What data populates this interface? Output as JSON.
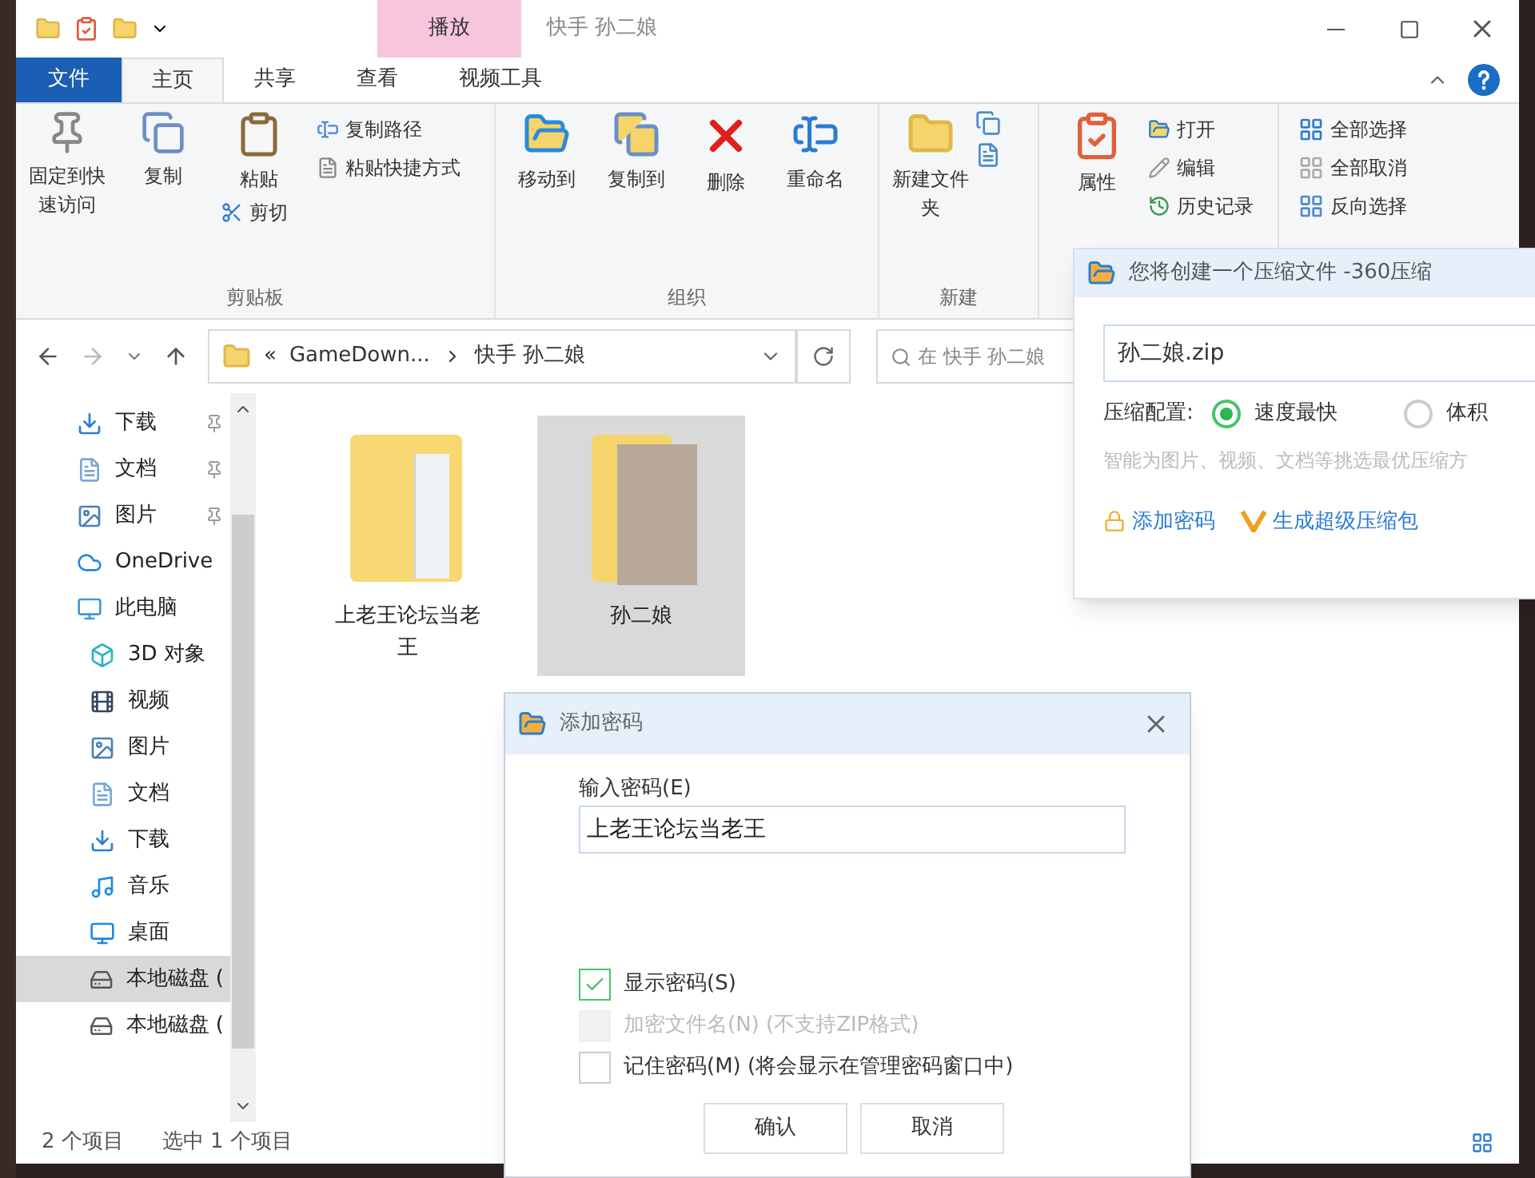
{
  "window": {
    "title": "快手 孙二娘",
    "context_tab": "播放"
  },
  "tabs": [
    {
      "label": "文件",
      "kind": "file",
      "selected": false
    },
    {
      "label": "主页",
      "kind": "tab",
      "selected": true
    },
    {
      "label": "共享",
      "kind": "tab",
      "selected": false
    },
    {
      "label": "查看",
      "kind": "tab",
      "selected": false
    },
    {
      "label": "视频工具",
      "kind": "context",
      "selected": false
    }
  ],
  "ribbon": {
    "clipboard": {
      "label": "剪贴板",
      "pin": "固定到快速访问",
      "copy": "复制",
      "paste": "粘贴",
      "cut": "剪切",
      "copy_path": "复制路径",
      "paste_shortcut": "粘贴快捷方式"
    },
    "organize": {
      "label": "组织",
      "move_to": "移动到",
      "copy_to": "复制到",
      "delete": "删除",
      "rename": "重命名"
    },
    "new": {
      "label": "新建",
      "new_folder": "新建文件夹"
    },
    "open": {
      "properties": "属性",
      "open": "打开",
      "edit": "编辑",
      "history": "历史记录"
    },
    "select": {
      "select_all": "全部选择",
      "select_none": "全部取消",
      "invert": "反向选择"
    }
  },
  "address": {
    "overflow": "«",
    "parent": "GameDown...",
    "current": "快手 孙二娘",
    "search_placeholder": "在 快手 孙二娘"
  },
  "nav": [
    {
      "label": "下载",
      "kind": "download",
      "pinned": true,
      "selected": false
    },
    {
      "label": "文档",
      "kind": "doc",
      "pinned": true,
      "selected": false
    },
    {
      "label": "图片",
      "kind": "image",
      "pinned": true,
      "selected": false
    },
    {
      "label": "OneDrive",
      "kind": "cloud",
      "pinned": false,
      "selected": false
    },
    {
      "label": "此电脑",
      "kind": "pc",
      "pinned": false,
      "selected": false,
      "children": [
        {
          "label": "3D 对象",
          "kind": "cube",
          "pinned": false,
          "selected": false
        },
        {
          "label": "视频",
          "kind": "video",
          "pinned": false,
          "selected": false
        },
        {
          "label": "图片",
          "kind": "image",
          "pinned": false,
          "selected": false
        },
        {
          "label": "文档",
          "kind": "doc",
          "pinned": false,
          "selected": false
        },
        {
          "label": "下载",
          "kind": "download",
          "pinned": false,
          "selected": false
        },
        {
          "label": "音乐",
          "kind": "music",
          "pinned": false,
          "selected": false
        },
        {
          "label": "桌面",
          "kind": "desktop",
          "pinned": false,
          "selected": false
        },
        {
          "label": "本地磁盘 (",
          "kind": "drive",
          "pinned": false,
          "selected": true
        },
        {
          "label": "本地磁盘 (",
          "kind": "drive",
          "pinned": false,
          "selected": false
        }
      ]
    }
  ],
  "files": [
    {
      "name": "上老王论坛当老王",
      "kind": "docs",
      "selected": false
    },
    {
      "name": "孙二娘",
      "kind": "photo",
      "selected": true
    }
  ],
  "status_bar": {
    "count": "2 个项目",
    "selection": "选中 1 个项目"
  },
  "compress_dialog": {
    "title": "您将创建一个压缩文件 -360压缩",
    "filename": "孙二娘.zip",
    "config_label": "压缩配置:",
    "options": [
      {
        "label": "速度最快",
        "selected": true
      },
      {
        "label": "体积",
        "selected": false
      }
    ],
    "hint": "智能为图片、视频、文档等挑选最优压缩方",
    "add_password": "添加密码",
    "super_pack": "生成超级压缩包"
  },
  "password_dialog": {
    "title": "添加密码",
    "input_label": "输入密码(E)",
    "value": "上老王论坛当老王",
    "options": [
      {
        "label": "显示密码(S)",
        "checked": true,
        "disabled": false
      },
      {
        "label": "加密文件名(N) (不支持ZIP格式)",
        "checked": false,
        "disabled": true
      },
      {
        "label": "记住密码(M) (将会显示在管理密码窗口中)",
        "checked": false,
        "disabled": false
      }
    ],
    "buttons": [
      "确认",
      "取消"
    ]
  }
}
